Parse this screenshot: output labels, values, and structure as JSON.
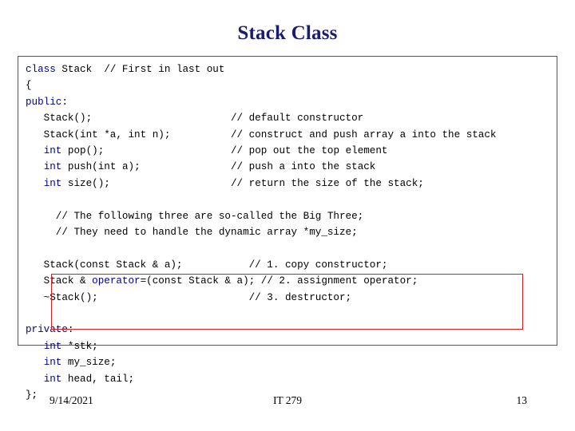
{
  "slide": {
    "title": "Stack Class",
    "code_lines": [
      {
        "segments": [
          {
            "t": "class",
            "k": true
          },
          {
            "t": " Stack  // First in last out",
            "k": false
          }
        ]
      },
      {
        "segments": [
          {
            "t": "{",
            "k": false
          }
        ]
      },
      {
        "segments": [
          {
            "t": "public",
            "k": true
          },
          {
            "t": ":",
            "k": false
          }
        ]
      },
      {
        "segments": [
          {
            "t": "   Stack();                       // default constructor",
            "k": false
          }
        ]
      },
      {
        "segments": [
          {
            "t": "   Stack(int *a, int n);          // construct and push array a into the stack",
            "k": false
          }
        ]
      },
      {
        "segments": [
          {
            "t": "   ",
            "k": false
          },
          {
            "t": "int",
            "k": true
          },
          {
            "t": " pop();                     // pop out the top element",
            "k": false
          }
        ]
      },
      {
        "segments": [
          {
            "t": "   ",
            "k": false
          },
          {
            "t": "int",
            "k": true
          },
          {
            "t": " push(int a);               // push a into the stack",
            "k": false
          }
        ]
      },
      {
        "segments": [
          {
            "t": "   ",
            "k": false
          },
          {
            "t": "int",
            "k": true
          },
          {
            "t": " size();                    // return the size of the stack;",
            "k": false
          }
        ]
      },
      {
        "segments": []
      },
      {
        "segments": [
          {
            "t": "     // The following three are so-called the Big Three;",
            "k": false
          }
        ]
      },
      {
        "segments": [
          {
            "t": "     // They need to handle the dynamic array *my_size;",
            "k": false
          }
        ]
      },
      {
        "segments": []
      },
      {
        "segments": [
          {
            "t": "   Stack(const Stack & a);           // 1. copy constructor;",
            "k": false
          }
        ]
      },
      {
        "segments": [
          {
            "t": "   Stack & ",
            "k": false
          },
          {
            "t": "operator",
            "k": true
          },
          {
            "t": "=(const Stack & a); // 2. assignment operator;",
            "k": false
          }
        ]
      },
      {
        "segments": [
          {
            "t": "   ~Stack();                         // 3. destructor;",
            "k": false
          }
        ]
      },
      {
        "segments": []
      },
      {
        "segments": [
          {
            "t": "private",
            "k": true
          },
          {
            "t": ":",
            "k": false
          }
        ]
      },
      {
        "segments": [
          {
            "t": "   ",
            "k": false
          },
          {
            "t": "int",
            "k": true
          },
          {
            "t": " *stk;",
            "k": false
          }
        ]
      },
      {
        "segments": [
          {
            "t": "   ",
            "k": false
          },
          {
            "t": "int",
            "k": true
          },
          {
            "t": " my_size;",
            "k": false
          }
        ]
      },
      {
        "segments": [
          {
            "t": "   ",
            "k": false
          },
          {
            "t": "int",
            "k": true
          },
          {
            "t": " head, tail;",
            "k": false
          }
        ]
      },
      {
        "segments": [
          {
            "t": "};",
            "k": false
          }
        ]
      }
    ],
    "highlight_color": "#d42020",
    "keyword_color": "#00008B",
    "title_color": "#1b1b6f"
  },
  "footer": {
    "date": "9/14/2021",
    "course": "IT 279",
    "page": "13"
  }
}
